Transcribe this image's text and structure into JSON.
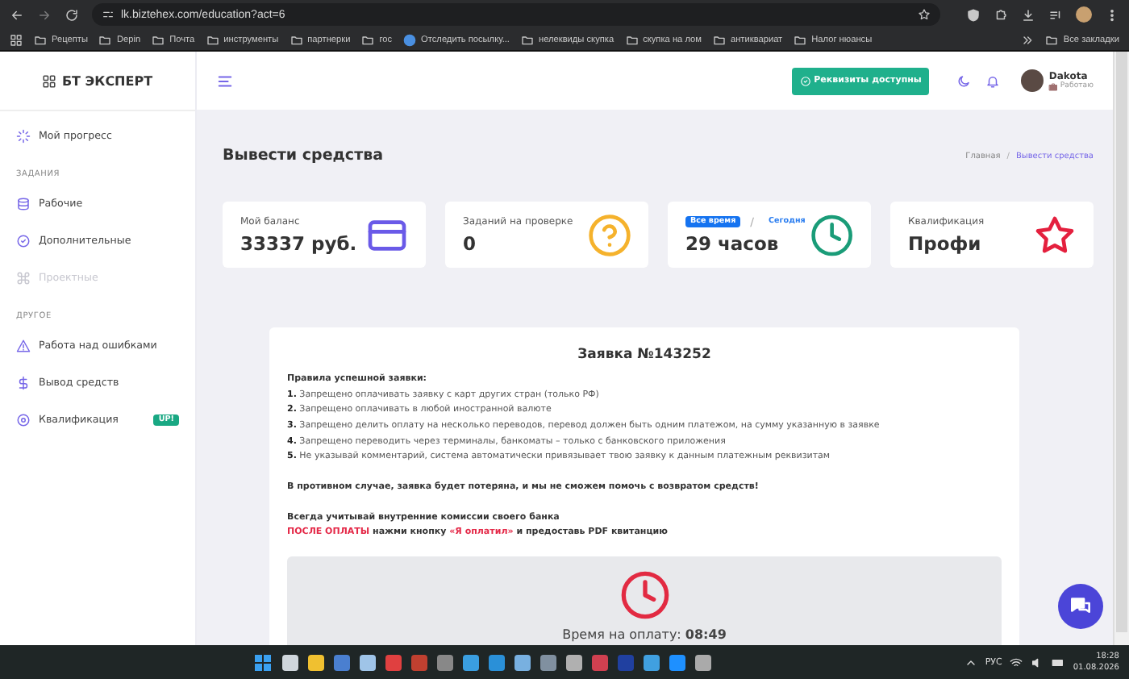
{
  "browser": {
    "url": "lk.biztehex.com/education?act=6",
    "bookmarks": [
      "Рецепты",
      "Depin",
      "Почта",
      "инструменты",
      "партнерки",
      "гос",
      "Отследить посылку...",
      "нелеквиды скупка",
      "скупка на лом",
      "антиквариат",
      "Налог нюансы"
    ],
    "all_bookmarks": "Все закладки"
  },
  "sidebar": {
    "logo": "БТ ЭКСПЕРТ",
    "items": [
      {
        "kind": "link",
        "label": "Мой прогресс",
        "disabled": false
      },
      {
        "kind": "heading",
        "label": "ЗАДАНИЯ"
      },
      {
        "kind": "link",
        "label": "Рабочие",
        "disabled": false
      },
      {
        "kind": "link",
        "label": "Дополнительные",
        "disabled": false
      },
      {
        "kind": "link",
        "label": "Проектные",
        "disabled": true
      },
      {
        "kind": "heading",
        "label": "ДРУГОЕ"
      },
      {
        "kind": "link",
        "label": "Работа над ошибками",
        "disabled": false
      },
      {
        "kind": "link",
        "label": "Вывод средств",
        "disabled": false
      },
      {
        "kind": "link",
        "label": "Квалификация",
        "disabled": false,
        "badge": "UP!"
      }
    ]
  },
  "header": {
    "button": "Реквизиты доступны",
    "user": {
      "name": "Dakota",
      "status": "Работаю"
    }
  },
  "page": {
    "title": "Вывести средства",
    "breadcrumb_separator": "/",
    "breadcrumbs": [
      {
        "label": "Главная",
        "selected": false
      },
      {
        "label": "Вывести средства",
        "selected": true
      }
    ]
  },
  "stats": [
    {
      "kind": "balance",
      "label": "Мой баланс",
      "value": "33337 руб."
    },
    {
      "kind": "review",
      "label": "Заданий на проверке",
      "value": "0"
    },
    {
      "kind": "hours",
      "tabs": [
        {
          "label": "Все время",
          "selected": true
        },
        {
          "label": "Сегодня",
          "selected": false
        }
      ],
      "separator": "/",
      "value": "29 часов"
    },
    {
      "kind": "qualification",
      "label": "Квалификация",
      "value": "Профи"
    }
  ],
  "order": {
    "title": "Заявка №143252",
    "rules_title": "Правила успешной заявки:",
    "rules": [
      "**1.** Запрещено оплачивать заявку с карт других стран (только РФ)",
      "**2.** Запрещено оплачивать в любой иностранной валюте",
      "**3.** Запрещено делить оплату на несколько переводов, перевод должен быть одним платежом, на сумму указанную в заявке",
      "**4.** Запрещено переводить через терминалы, банкоматы – только с банковского приложения",
      "**5.** Не указывай комментарий, система автоматически привязывает твою заявку к данным платежным реквизитам"
    ],
    "warning": "В противном случае, заявка будет потеряна, и мы не сможем помочь с возвратом средств!",
    "note": "Всегда учитывай внутренние комиссии своего банка",
    "instruction": [
      {
        "text": "ПОСЛЕ ОПЛАТЫ",
        "highlight": true
      },
      {
        "text": " нажми кнопку ",
        "highlight": false
      },
      {
        "text": "«Я оплатил»",
        "highlight": true
      },
      {
        "text": " и предоставь PDF квитанцию",
        "highlight": false
      }
    ],
    "timer": {
      "label": "Время на оплату:",
      "value": "08:49"
    }
  },
  "taskbar": {
    "language": "РУС",
    "time": "18:28",
    "date": "01.08.2026"
  }
}
